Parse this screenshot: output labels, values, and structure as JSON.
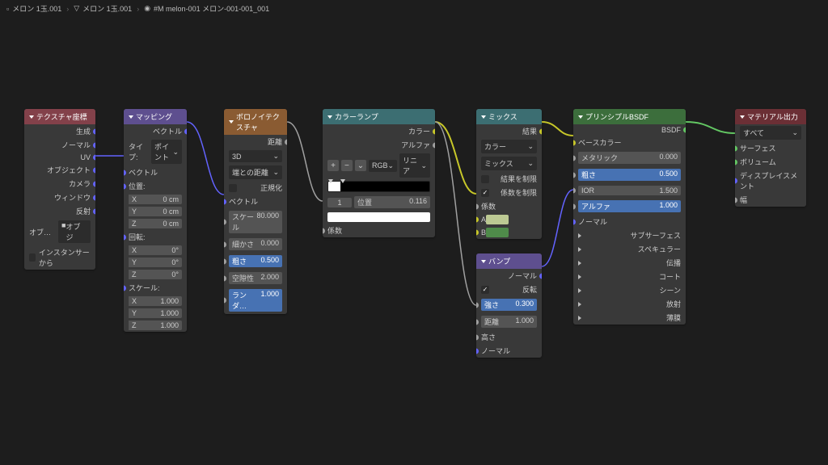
{
  "breadcrumb": {
    "a": "メロン 1玉.001",
    "b": "メロン 1玉.001",
    "c": "#M melon-001 メロン-001-001_001"
  },
  "texcoord": {
    "title": "テクスチャ座標",
    "out": [
      "生成",
      "ノーマル",
      "UV",
      "オブジェクト",
      "カメラ",
      "ウィンドウ",
      "反射"
    ],
    "obj_label": "オブ…",
    "obj_field": "オブジ",
    "instancer": "インスタンサーから"
  },
  "mapping": {
    "title": "マッピング",
    "out_vec": "ベクトル",
    "type_l": "タイプ:",
    "type_v": "ポイント",
    "in_vec": "ベクトル",
    "loc": "位置:",
    "rot": "回転:",
    "scale": "スケール:",
    "loc_x": "X",
    "loc_xv": "0 cm",
    "loc_y": "Y",
    "loc_yv": "0 cm",
    "loc_z": "Z",
    "loc_zv": "0 cm",
    "rot_x": "X",
    "rot_xv": "0°",
    "rot_y": "Y",
    "rot_yv": "0°",
    "rot_z": "Z",
    "rot_zv": "0°",
    "sc_x": "X",
    "sc_xv": "1.000",
    "sc_y": "Y",
    "sc_yv": "1.000",
    "sc_z": "Z",
    "sc_zv": "1.000"
  },
  "voronoi": {
    "title": "ボロノイテクスチャ",
    "out_dist": "距離",
    "dim": "3D",
    "feat": "端との距離",
    "norm": "正規化",
    "in_vec": "ベクトル",
    "scale_l": "スケール",
    "scale_v": "80.000",
    "detail_l": "細かさ",
    "detail_v": "0.000",
    "rough_l": "粗さ",
    "rough_v": "0.500",
    "lac_l": "空隙性",
    "lac_v": "2.000",
    "rand_l": "ランダ…",
    "rand_v": "1.000"
  },
  "ramp": {
    "title": "カラーランプ",
    "out_color": "カラー",
    "out_alpha": "アルファ",
    "mode_a": "RGB",
    "mode_b": "リニア",
    "idx": "1",
    "pos_l": "位置",
    "pos_v": "0.116",
    "in_fac": "係数"
  },
  "mix": {
    "title": "ミックス",
    "out": "結果",
    "type": "カラー",
    "blend": "ミックス",
    "clamp_res": "結果を制限",
    "clamp_fac": "係数を制限",
    "fac_l": "係数",
    "a": "A",
    "b": "B"
  },
  "bump": {
    "title": "バンプ",
    "out": "ノーマル",
    "invert": "反転",
    "str_l": "強さ",
    "str_v": "0.300",
    "dist_l": "距離",
    "dist_v": "1.000",
    "height": "高さ",
    "normal": "ノーマル"
  },
  "bsdf": {
    "title": "プリンシプルBSDF",
    "out": "BSDF",
    "base": "ベースカラー",
    "met_l": "メタリック",
    "met_v": "0.000",
    "rough_l": "粗さ",
    "rough_v": "0.500",
    "ior_l": "IOR",
    "ior_v": "1.500",
    "alpha_l": "アルファ",
    "alpha_v": "1.000",
    "normal": "ノーマル",
    "g1": "サブサーフェス",
    "g2": "スペキュラー",
    "g3": "伝播",
    "g4": "コート",
    "g5": "シーン",
    "g6": "放射",
    "g7": "薄膜"
  },
  "output": {
    "title": "マテリアル出力",
    "target": "すべて",
    "surf": "サーフェス",
    "vol": "ボリューム",
    "disp": "ディスプレイスメント",
    "thick": "幅"
  }
}
